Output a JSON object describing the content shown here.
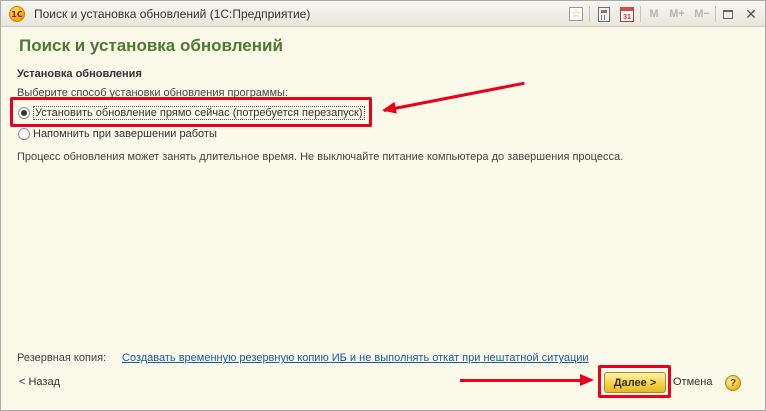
{
  "window": {
    "logo_text": "1С",
    "title": "Поиск и установка обновлений  (1С:Предприятие)"
  },
  "toolbar": {
    "fav_glyph": "☆",
    "cal_glyph": "31",
    "m": "M",
    "m_plus": "M+",
    "m_minus": "M−",
    "close_glyph": "✕"
  },
  "page": {
    "heading": "Поиск и установка обновлений",
    "section_title": "Установка обновления",
    "prompt": "Выберите способ установки обновления программы:",
    "options": [
      {
        "label": "Установить обновление прямо сейчас (потребуется перезапуск)",
        "checked": true
      },
      {
        "label": "Напомнить при завершении работы",
        "checked": false
      }
    ],
    "note": "Процесс обновления может занять длительное время. Не выключайте питание компьютера до завершения процесса."
  },
  "footer": {
    "backup_label": "Резервная копия:",
    "backup_link": "Создавать временную резервную копию ИБ и не выполнять откат при нештатной ситуации",
    "back_label": "< Назад",
    "next_label": "Далее >",
    "cancel_label": "Отмена",
    "help_glyph": "?"
  },
  "colors": {
    "heading": "#4d7a2e",
    "annotation": "#e8001c",
    "link": "#1a5aa8",
    "background": "#fbf9ea"
  }
}
